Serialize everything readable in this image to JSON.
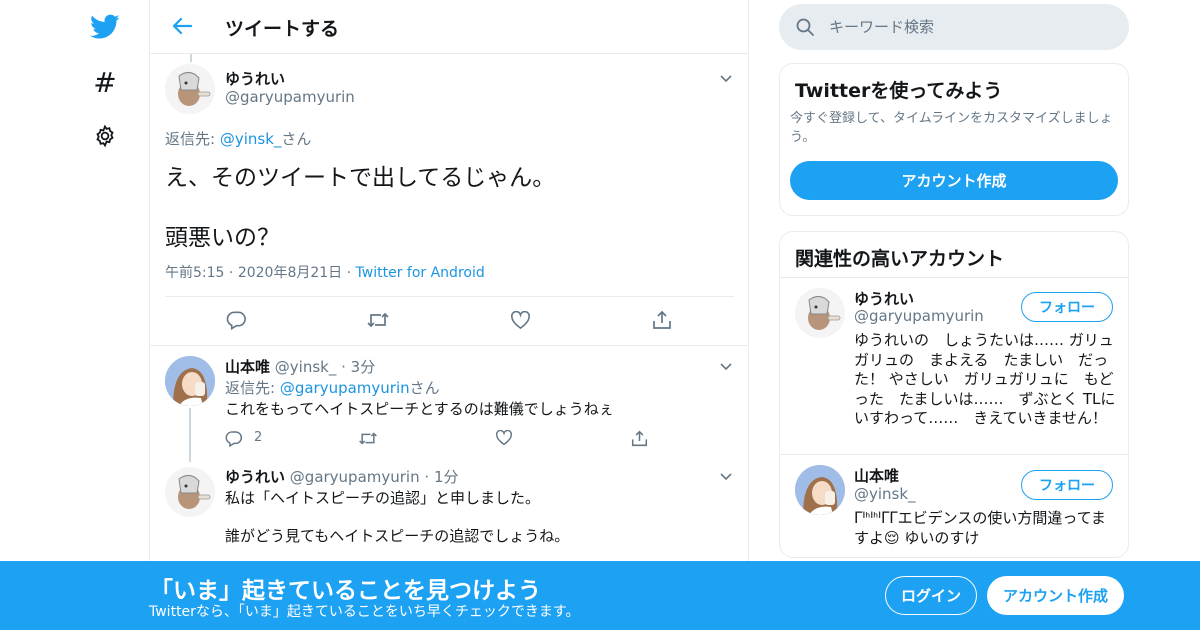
{
  "header": {
    "title": "ツイートする"
  },
  "main_tweet": {
    "name": "ゆうれい",
    "handle": "@garyupamyurin",
    "reply_prefix": "返信先: ",
    "reply_mention": "@yinsk_",
    "reply_suffix": "さん",
    "text_line1": "え、そのツイートで出してるじゃん。",
    "text_line2": "頭悪いの？",
    "time": "午前5:15",
    "sep": " · ",
    "date": "2020年8月21日",
    "source": "Twitter for Android"
  },
  "replies": [
    {
      "name": "山本唯",
      "handle": "@yinsk_",
      "time": "3分",
      "dot": " · ",
      "reply_prefix": "返信先: ",
      "reply_mention": "@garyupamyurin",
      "reply_suffix": "さん",
      "text": "これをもってヘイトスピーチとするのは難儀でしょうねぇ",
      "reply_count": "2"
    },
    {
      "name": "ゆうれい",
      "handle": "@garyupamyurin",
      "time": "1分",
      "dot": " · ",
      "text_line1": "私は「ヘイトスピーチの追認」と申しました。",
      "text_line2": "誰がどう見てもヘイトスピーチの追認でしょうね。"
    }
  ],
  "search": {
    "placeholder": "キーワード検索"
  },
  "signup_card": {
    "title": "Twitterを使ってみよう",
    "description": "今すぐ登録して、タイムラインをカスタマイズしましょう。",
    "button": "アカウント作成"
  },
  "related_card": {
    "title": "関連性の高いアカウント",
    "accounts": [
      {
        "name": "ゆうれい",
        "handle": "@garyupamyurin",
        "follow": "フォロー",
        "bio": "ゆうれいの　しょうたいは…… ガリュガリュの　まよえる　たましい　だった！ やさしい　ガリュガリュに　もどった　たましいは……　ずぶとく TLにいすわって……　きえていきません！"
      },
      {
        "name": "山本唯",
        "handle": "@yinsk_",
        "follow": "フォロー",
        "bio": "ᒥᑊᑋᑊᑋᑊᒥᒥエビデンスの使い方間違ってますよ😌 ゆいのすけ"
      }
    ]
  },
  "banner": {
    "title": "「いま」起きていることを見つけよう",
    "subtitle": "Twitterなら、「いま」起きていることをいち早くチェックできます。",
    "login": "ログイン",
    "signup": "アカウント作成"
  },
  "colors": {
    "accent": "#1da1f2",
    "link": "#1b95e0",
    "muted": "#657786",
    "border": "#e6ecf0"
  }
}
